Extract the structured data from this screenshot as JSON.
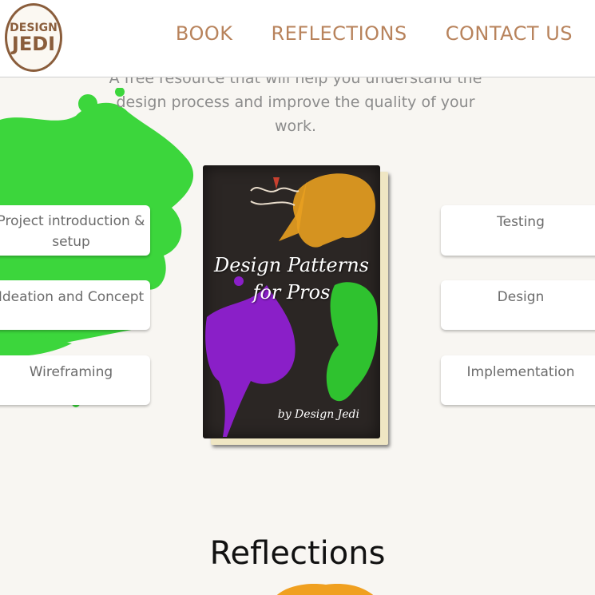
{
  "logo": {
    "line1": "DESIGN",
    "line2": "JEDI"
  },
  "nav": {
    "items": [
      "BOOK",
      "REFLECTIONS",
      "CONTACT US"
    ]
  },
  "intro": {
    "text": "A free resource that will help you understand the design process and improve the quality of your work."
  },
  "steps_left": [
    "Project introduction & setup",
    "Ideation and Concept",
    "Wireframing"
  ],
  "steps_right": [
    "Testing",
    "Design",
    "Implementation"
  ],
  "book": {
    "title_line1": "Design Patterns",
    "title_line2": "for Pros",
    "author": "by Design Jedi"
  },
  "section_heading": "Reflections",
  "colors": {
    "background": "#f8f6f2",
    "nav": "#b8835c",
    "splash_green": "#3cd63c",
    "splash_orange": "#f0a020",
    "splash_purple": "#8a1fc8",
    "cover": "#2b2624"
  }
}
